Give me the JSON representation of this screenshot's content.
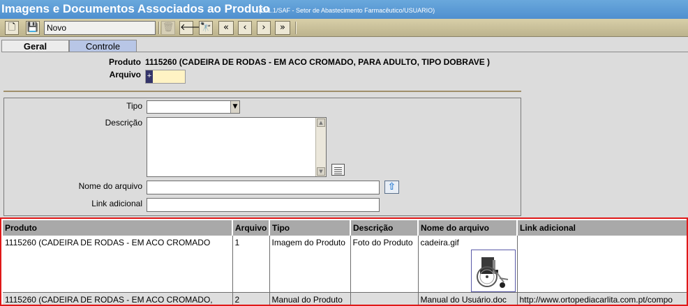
{
  "window": {
    "title": "Imagens e Documentos Associados ao Produto",
    "subtitle": "(O/1.1/SAF - Setor de Abastecimento Farmacêutico/USUARIO)"
  },
  "toolbar": {
    "record_field": "Novo",
    "buttons": [
      {
        "icon": "new-document-icon",
        "glyph": "🗋"
      },
      {
        "icon": "save-icon",
        "glyph": "💾"
      },
      {
        "icon": "delete-icon",
        "glyph": "🗑"
      },
      {
        "icon": "back-arrow-icon",
        "glyph": "🡐"
      },
      {
        "icon": "binoculars-icon",
        "glyph": "🔭"
      },
      {
        "icon": "first-record-icon",
        "glyph": "«"
      },
      {
        "icon": "previous-record-icon",
        "glyph": "‹"
      },
      {
        "icon": "next-record-icon",
        "glyph": "›"
      },
      {
        "icon": "last-record-icon",
        "glyph": "»"
      }
    ]
  },
  "tabs": [
    {
      "label": "Geral",
      "active": true
    },
    {
      "label": "Controle",
      "active": false
    }
  ],
  "header": {
    "produto_label": "Produto",
    "produto_value": "1115260  (CADEIRA DE RODAS - EM ACO CROMADO, PARA ADULTO, TIPO DOBRAVE )",
    "arquivo_label": "Arquivo",
    "arquivo_value": "+"
  },
  "form": {
    "tipo_label": "Tipo",
    "tipo_value": "",
    "descricao_label": "Descrição",
    "descricao_value": "",
    "nome_arquivo_label": "Nome do arquivo",
    "nome_arquivo_value": "",
    "link_label": "Link adicional",
    "link_value": ""
  },
  "grid": {
    "columns": [
      "Produto",
      "Arquivo",
      "Tipo",
      "Descrição",
      "Nome do arquivo",
      "Link adicional"
    ],
    "rows": [
      {
        "produto": "1115260 (CADEIRA DE RODAS - EM ACO CROMADO",
        "arquivo": "1",
        "tipo": "Imagem do Produto",
        "descricao": "Foto do Produto",
        "nome_arquivo": "cadeira.gif",
        "link": ""
      },
      {
        "produto": "1115260 (CADEIRA DE RODAS - EM ACO CROMADO,",
        "arquivo": "2",
        "tipo": "Manual do Produto",
        "descricao": "",
        "nome_arquivo": "Manual  do  Usuário.doc",
        "link": "http://www.ortopediacarlita.com.pt/compo"
      }
    ]
  }
}
